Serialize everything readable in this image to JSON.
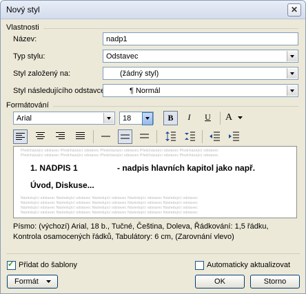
{
  "window": {
    "title": "Nový styl",
    "close_glyph": "✕"
  },
  "properties": {
    "group_label": "Vlastnosti",
    "name_label": "Název:",
    "name_value": "nadp1",
    "style_type_label": "Typ stylu:",
    "style_type_value": "Odstavec",
    "based_on_label": "Styl založený na:",
    "based_on_value": "(žádný styl)",
    "next_style_label": "Styl následujícího odstavce:",
    "next_style_value": "¶ Normál"
  },
  "formatting": {
    "group_label": "Formátování",
    "font_value": "Arial",
    "size_value": "18",
    "bold_label": "B",
    "italic_label": "I",
    "underline_label": "U",
    "font_color_label": "A",
    "icons": [
      "bold-icon",
      "italic-icon",
      "underline-icon",
      "font-color-icon",
      "align-left-icon",
      "align-center-icon",
      "align-right-icon",
      "justify-icon",
      "single-spacing-icon",
      "one-half-spacing-icon",
      "double-spacing-icon",
      "increase-spacing-icon",
      "decrease-spacing-icon",
      "decrease-indent-icon",
      "increase-indent-icon"
    ]
  },
  "preview": {
    "ghost_text": "Předcházející odstavec Předcházející odstavec Předcházející odstavec Předcházející odstavec Předcházející odstavec",
    "ghost_text_next": "Následující odstavec Následující odstavec Následující odstavec Následující odstavec Následující odstavec",
    "line1_number": "1. NADPIS 1",
    "line1_rest": "- nadpis hlavních kapitol jako např.",
    "line2": "Úvod, Diskuse..."
  },
  "description": "Písmo: (výchozí) Arial, 18 b., Tučné, Čeština, Doleva, Řádkování:  1,5 řádku, Kontrola osamocených řádků, Tabulátory:  6 cm, (Zarovnání vlevo)",
  "options": {
    "add_to_template_label": "Přidat do šablony",
    "add_to_template_checked": true,
    "auto_update_label": "Automaticky aktualizovat",
    "auto_update_checked": false
  },
  "buttons": {
    "format_label": "Formát",
    "ok_label": "OK",
    "cancel_label": "Storno"
  }
}
